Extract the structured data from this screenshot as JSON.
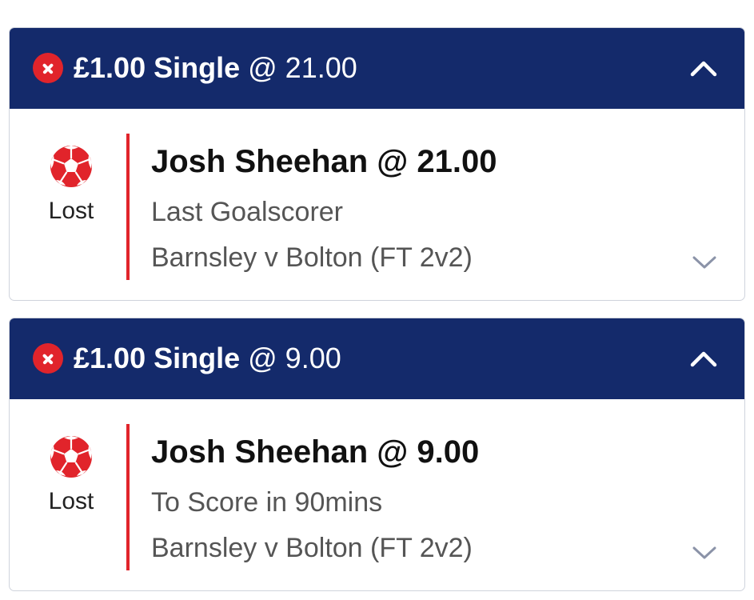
{
  "bets": [
    {
      "header": {
        "stake_type": "£1.00 Single",
        "odds_label": "@ 21.00"
      },
      "status_icon": "cross-circle-icon",
      "sport_icon": "football-icon",
      "result": "Lost",
      "selection": "Josh Sheehan @ 21.00",
      "market": "Last Goalscorer",
      "event": "Barnsley v Bolton (FT 2v2)"
    },
    {
      "header": {
        "stake_type": "£1.00 Single",
        "odds_label": "@ 9.00"
      },
      "status_icon": "cross-circle-icon",
      "sport_icon": "football-icon",
      "result": "Lost",
      "selection": "Josh Sheehan @ 9.00",
      "market": "To Score in 90mins",
      "event": "Barnsley v Bolton (FT 2v2)"
    }
  ],
  "colors": {
    "header_bg": "#142a6b",
    "lost_red": "#e1242b",
    "chevron_grey": "#8b93a8"
  }
}
